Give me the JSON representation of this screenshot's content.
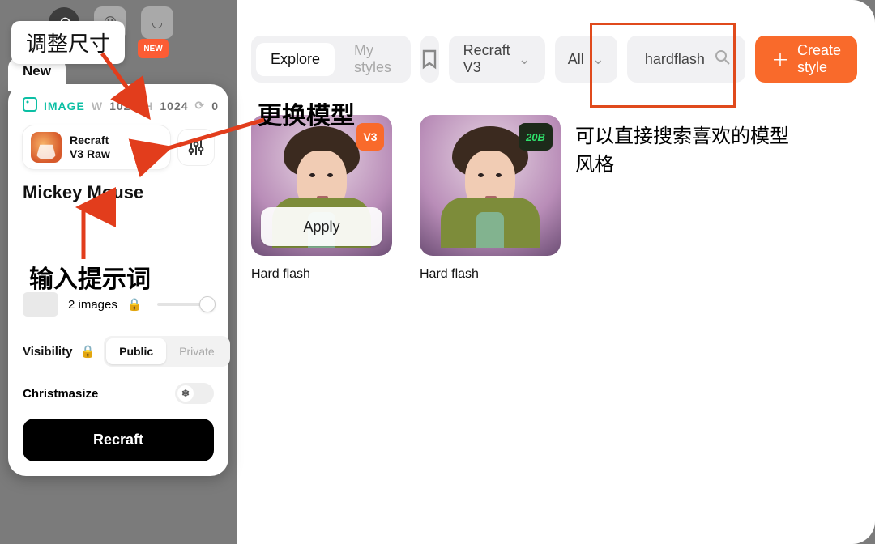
{
  "toolbar_ghost": {
    "new_badge": "New"
  },
  "panel": {
    "tab": "New",
    "image_label": "IMAGE",
    "width_label": "W",
    "width_value": "1024",
    "height_label": "H",
    "height_value": "1024",
    "count_label": "",
    "count_value": "0",
    "model_line1": "Recraft",
    "model_line2": "V3 Raw",
    "prompt_value": "Mickey Mouse",
    "images_count_label": "2 images",
    "visibility_label": "Visibility",
    "visibility_public": "Public",
    "visibility_private": "Private",
    "christmasize_label": "Christmasize",
    "recraft_button": "Recraft"
  },
  "filterbar": {
    "explore": "Explore",
    "my_styles": "My styles",
    "model_dropdown": "Recraft V3",
    "filter_all": "All",
    "search_value": "hardflash",
    "create_style": "Create style"
  },
  "results": [
    {
      "caption": "Hard flash",
      "apply": "Apply",
      "badge": "V3"
    },
    {
      "caption": "Hard flash",
      "badge": "20B"
    }
  ],
  "annotations": {
    "resize_label": "调整尺寸",
    "change_model_label": "更换模型",
    "prompt_label": "输入提示词",
    "search_hint_line1": "可以直接搜索喜欢的模型",
    "search_hint_line2": "风格"
  }
}
